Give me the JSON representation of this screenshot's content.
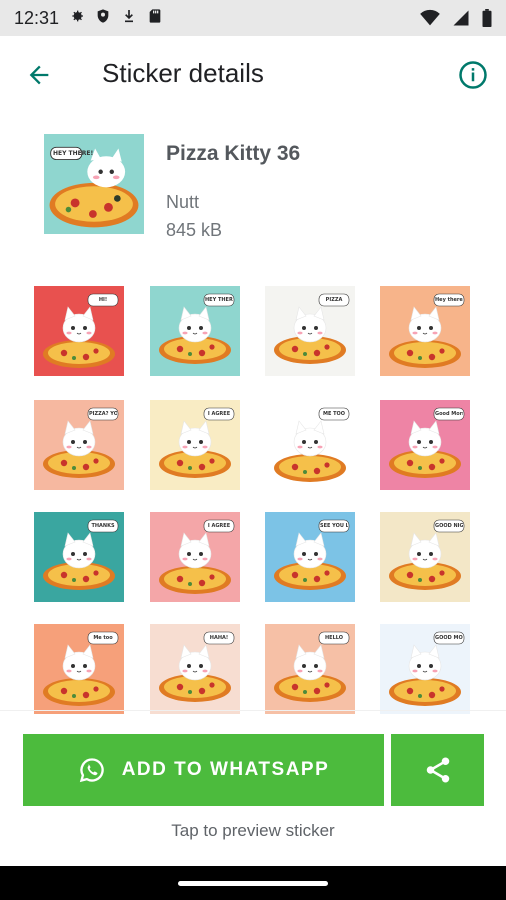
{
  "status_bar": {
    "time": "12:31",
    "left_icons": [
      "settings-icon",
      "shield-icon",
      "download-icon",
      "sd-card-icon"
    ],
    "right_icons": [
      "wifi-icon",
      "signal-icon",
      "battery-icon"
    ]
  },
  "app_bar": {
    "title": "Sticker details",
    "back_icon": "arrow-back-icon",
    "info_icon": "info-icon",
    "accent_color": "#00796b"
  },
  "pack": {
    "name": "Pizza Kitty 36",
    "author": "Nutt",
    "size": "845 kB",
    "thumb_caption": "HEY THERE!"
  },
  "stickers": [
    {
      "bg": "#e8514f",
      "caption": "HI!"
    },
    {
      "bg": "#8fd6cf",
      "caption": "HEY THERE!"
    },
    {
      "bg": "#f4f4f1",
      "caption": "PIZZA"
    },
    {
      "bg": "#f7b48a",
      "caption": "Hey there!"
    },
    {
      "bg": "#f6b8a0",
      "caption": "PIZZA? YOU GOT?"
    },
    {
      "bg": "#f9ecc4",
      "caption": "I AGREE"
    },
    {
      "bg": "#ffffff",
      "caption": "ME TOO"
    },
    {
      "bg": "#ee84a5",
      "caption": "Good Morning"
    },
    {
      "bg": "#3aa6a0",
      "caption": "THANKS"
    },
    {
      "bg": "#f4a6a8",
      "caption": "I AGREE"
    },
    {
      "bg": "#7cc3e6",
      "caption": "SEE YOU LATER!"
    },
    {
      "bg": "#f3e7c7",
      "caption": "GOOD NIGHT"
    },
    {
      "bg": "#f6a07a",
      "caption": "Me too"
    },
    {
      "bg": "#f7ddd1",
      "caption": "HAHA!"
    },
    {
      "bg": "#f6c0a6",
      "caption": "HELLO"
    },
    {
      "bg": "#edf4fb",
      "caption": "GOOD MORNING"
    }
  ],
  "actions": {
    "add_label": "ADD TO WHATSAPP",
    "add_icon": "whatsapp-icon",
    "share_icon": "share-icon",
    "button_color": "#4cbb3d"
  },
  "hint": "Tap to preview sticker"
}
